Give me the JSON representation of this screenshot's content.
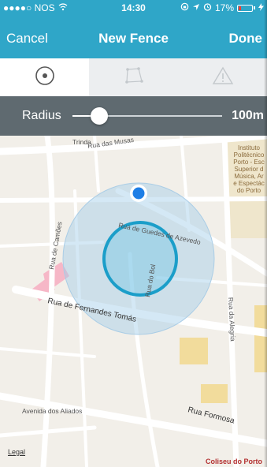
{
  "status_bar": {
    "carrier": "●●●●○ NOS",
    "time": "14:30",
    "battery_percent": "17%",
    "battery_level": 0.17,
    "battery_color": "#ff3b30"
  },
  "nav": {
    "left_label": "Cancel",
    "title": "New Fence",
    "right_label": "Done"
  },
  "segments": [
    {
      "icon": "circle-target-icon",
      "selected": true
    },
    {
      "icon": "polygon-icon",
      "selected": false
    },
    {
      "icon": "warning-triangle-icon",
      "selected": false
    }
  ],
  "radius": {
    "label": "Radius",
    "value_text": "100m",
    "slider_fraction": 0.18
  },
  "map": {
    "streets": [
      "Rua das Musas",
      "Rua de Camões",
      "Rua de Guedes de Azevedo",
      "Rua do Bol",
      "Rua de Fernandes Tomás",
      "Rua da Alegria",
      "Rua Formosa",
      "Avenida dos Aliados",
      "Trinda"
    ],
    "poi_lines": [
      "Instituto",
      "Politécnico",
      "Porto - Esc",
      "Superior d",
      "Música, Ar",
      "e Espectác",
      "do Porto"
    ],
    "legal": "Legal",
    "poi_bottom": "Coliseu do Porto",
    "accent": "#1b9ec9",
    "location_dot": "#1f7fe6"
  },
  "colors": {
    "header": "#2fa6c8",
    "radius_bar": "#5f6a70"
  }
}
